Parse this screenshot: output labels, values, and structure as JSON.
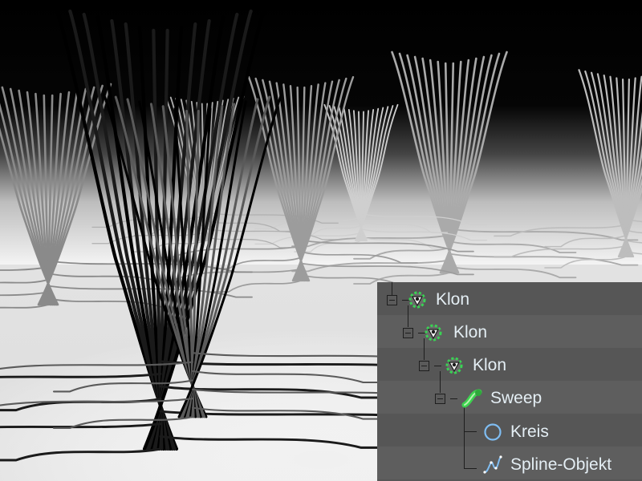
{
  "scene": {
    "background_top": "#000000",
    "floor_color": "#f2f2f2",
    "stem_colors": [
      "#000000",
      "#3a3a3a",
      "#9a9a9a",
      "#dcdcdc"
    ]
  },
  "object_manager": {
    "background": "#565656",
    "text_color": "#e4eef4",
    "accent": "#39d353",
    "items": [
      {
        "label": "Klon",
        "icon": "cloner-icon"
      },
      {
        "label": "Klon",
        "icon": "cloner-icon"
      },
      {
        "label": "Klon",
        "icon": "cloner-icon"
      },
      {
        "label": "Sweep",
        "icon": "sweep-icon"
      },
      {
        "label": "Kreis",
        "icon": "circle-spline-icon"
      },
      {
        "label": "Spline-Objekt",
        "icon": "spline-icon"
      }
    ]
  }
}
